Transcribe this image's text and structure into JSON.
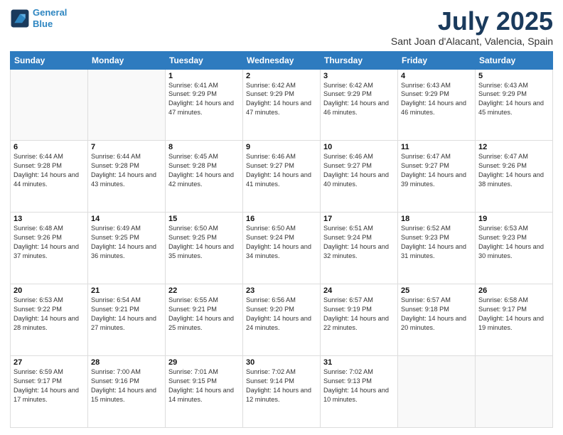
{
  "logo": {
    "line1": "General",
    "line2": "Blue"
  },
  "title": "July 2025",
  "subtitle": "Sant Joan d'Alacant, Valencia, Spain",
  "days_header": [
    "Sunday",
    "Monday",
    "Tuesday",
    "Wednesday",
    "Thursday",
    "Friday",
    "Saturday"
  ],
  "weeks": [
    [
      {
        "day": "",
        "info": ""
      },
      {
        "day": "",
        "info": ""
      },
      {
        "day": "1",
        "info": "Sunrise: 6:41 AM\nSunset: 9:29 PM\nDaylight: 14 hours and 47 minutes."
      },
      {
        "day": "2",
        "info": "Sunrise: 6:42 AM\nSunset: 9:29 PM\nDaylight: 14 hours and 47 minutes."
      },
      {
        "day": "3",
        "info": "Sunrise: 6:42 AM\nSunset: 9:29 PM\nDaylight: 14 hours and 46 minutes."
      },
      {
        "day": "4",
        "info": "Sunrise: 6:43 AM\nSunset: 9:29 PM\nDaylight: 14 hours and 46 minutes."
      },
      {
        "day": "5",
        "info": "Sunrise: 6:43 AM\nSunset: 9:29 PM\nDaylight: 14 hours and 45 minutes."
      }
    ],
    [
      {
        "day": "6",
        "info": "Sunrise: 6:44 AM\nSunset: 9:28 PM\nDaylight: 14 hours and 44 minutes."
      },
      {
        "day": "7",
        "info": "Sunrise: 6:44 AM\nSunset: 9:28 PM\nDaylight: 14 hours and 43 minutes."
      },
      {
        "day": "8",
        "info": "Sunrise: 6:45 AM\nSunset: 9:28 PM\nDaylight: 14 hours and 42 minutes."
      },
      {
        "day": "9",
        "info": "Sunrise: 6:46 AM\nSunset: 9:27 PM\nDaylight: 14 hours and 41 minutes."
      },
      {
        "day": "10",
        "info": "Sunrise: 6:46 AM\nSunset: 9:27 PM\nDaylight: 14 hours and 40 minutes."
      },
      {
        "day": "11",
        "info": "Sunrise: 6:47 AM\nSunset: 9:27 PM\nDaylight: 14 hours and 39 minutes."
      },
      {
        "day": "12",
        "info": "Sunrise: 6:47 AM\nSunset: 9:26 PM\nDaylight: 14 hours and 38 minutes."
      }
    ],
    [
      {
        "day": "13",
        "info": "Sunrise: 6:48 AM\nSunset: 9:26 PM\nDaylight: 14 hours and 37 minutes."
      },
      {
        "day": "14",
        "info": "Sunrise: 6:49 AM\nSunset: 9:25 PM\nDaylight: 14 hours and 36 minutes."
      },
      {
        "day": "15",
        "info": "Sunrise: 6:50 AM\nSunset: 9:25 PM\nDaylight: 14 hours and 35 minutes."
      },
      {
        "day": "16",
        "info": "Sunrise: 6:50 AM\nSunset: 9:24 PM\nDaylight: 14 hours and 34 minutes."
      },
      {
        "day": "17",
        "info": "Sunrise: 6:51 AM\nSunset: 9:24 PM\nDaylight: 14 hours and 32 minutes."
      },
      {
        "day": "18",
        "info": "Sunrise: 6:52 AM\nSunset: 9:23 PM\nDaylight: 14 hours and 31 minutes."
      },
      {
        "day": "19",
        "info": "Sunrise: 6:53 AM\nSunset: 9:23 PM\nDaylight: 14 hours and 30 minutes."
      }
    ],
    [
      {
        "day": "20",
        "info": "Sunrise: 6:53 AM\nSunset: 9:22 PM\nDaylight: 14 hours and 28 minutes."
      },
      {
        "day": "21",
        "info": "Sunrise: 6:54 AM\nSunset: 9:21 PM\nDaylight: 14 hours and 27 minutes."
      },
      {
        "day": "22",
        "info": "Sunrise: 6:55 AM\nSunset: 9:21 PM\nDaylight: 14 hours and 25 minutes."
      },
      {
        "day": "23",
        "info": "Sunrise: 6:56 AM\nSunset: 9:20 PM\nDaylight: 14 hours and 24 minutes."
      },
      {
        "day": "24",
        "info": "Sunrise: 6:57 AM\nSunset: 9:19 PM\nDaylight: 14 hours and 22 minutes."
      },
      {
        "day": "25",
        "info": "Sunrise: 6:57 AM\nSunset: 9:18 PM\nDaylight: 14 hours and 20 minutes."
      },
      {
        "day": "26",
        "info": "Sunrise: 6:58 AM\nSunset: 9:17 PM\nDaylight: 14 hours and 19 minutes."
      }
    ],
    [
      {
        "day": "27",
        "info": "Sunrise: 6:59 AM\nSunset: 9:17 PM\nDaylight: 14 hours and 17 minutes."
      },
      {
        "day": "28",
        "info": "Sunrise: 7:00 AM\nSunset: 9:16 PM\nDaylight: 14 hours and 15 minutes."
      },
      {
        "day": "29",
        "info": "Sunrise: 7:01 AM\nSunset: 9:15 PM\nDaylight: 14 hours and 14 minutes."
      },
      {
        "day": "30",
        "info": "Sunrise: 7:02 AM\nSunset: 9:14 PM\nDaylight: 14 hours and 12 minutes."
      },
      {
        "day": "31",
        "info": "Sunrise: 7:02 AM\nSunset: 9:13 PM\nDaylight: 14 hours and 10 minutes."
      },
      {
        "day": "",
        "info": ""
      },
      {
        "day": "",
        "info": ""
      }
    ]
  ]
}
